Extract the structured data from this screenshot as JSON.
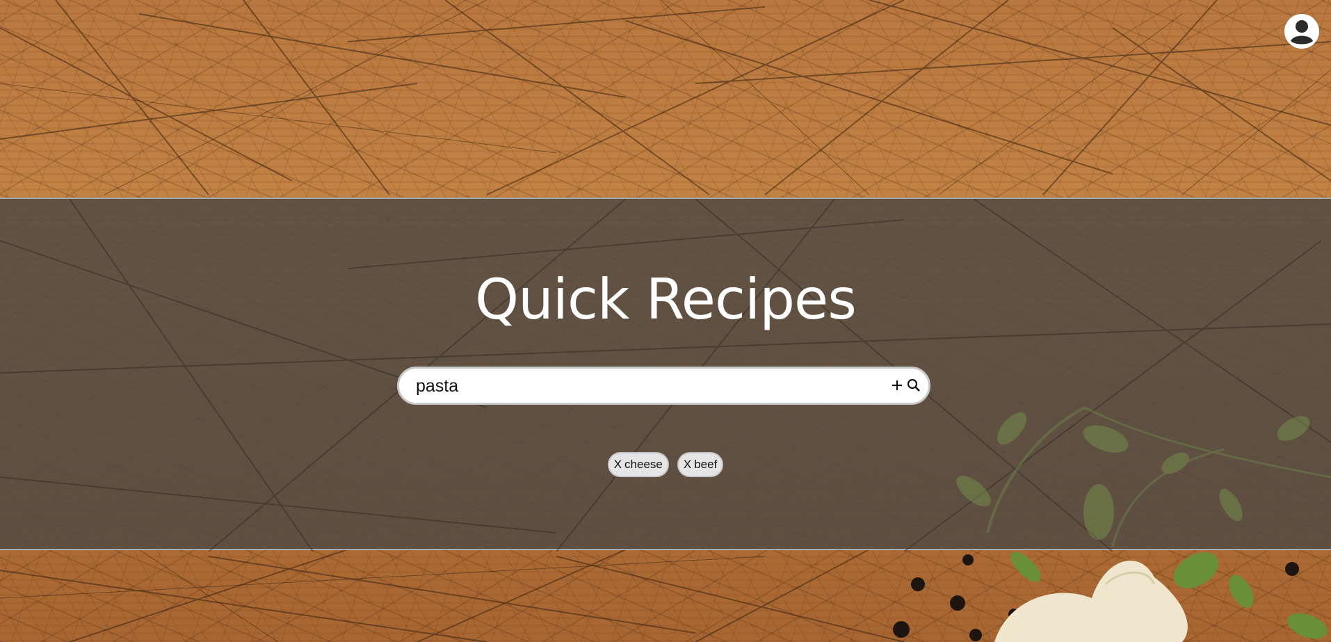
{
  "app": {
    "title": "Quick Recipes"
  },
  "header": {
    "account_icon": "account-circle-icon"
  },
  "search": {
    "value": "pasta",
    "placeholder": "",
    "add_icon": "plus-icon",
    "search_icon": "search-icon"
  },
  "filters": [
    {
      "remove_label": "X",
      "label": "cheese"
    },
    {
      "remove_label": "X",
      "label": "beef"
    }
  ],
  "colors": {
    "banner": "#524a44",
    "title_text": "#ffffff",
    "chip_bg": "#e5e5e5",
    "wood": "#b9783f"
  }
}
